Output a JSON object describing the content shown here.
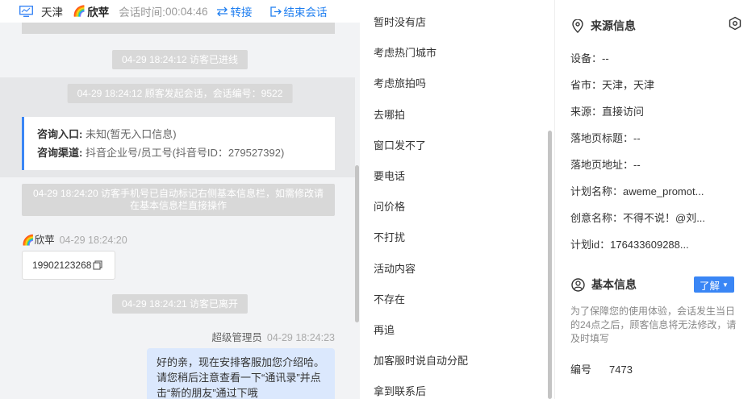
{
  "chat": {
    "header": {
      "city": "天津",
      "agent": "欣苹",
      "timer_label": "会话时间:",
      "timer": "00:04:46",
      "transfer": "转接",
      "end": "结束会话"
    },
    "sys_entered": "04-29 18:24:12 访客已进线",
    "sys_started": "04-29 18:24:12 顾客发起会话，会话编号：9522",
    "consult": {
      "entry_label": "咨询入口:",
      "entry_value": "未知(暂无入口信息)",
      "channel_label": "咨询渠道:",
      "channel_value": "抖音企业号/员工号(抖音号ID：279527392)"
    },
    "sys_phone": "04-29 18:24:20 访客手机号已自动标记右侧基本信息栏，如需修改请在基本信息栏直接操作",
    "agent_msg": {
      "name": "欣苹",
      "time": "04-29 18:24:20",
      "phone": "19902123268"
    },
    "sys_left": "04-29 18:24:21 访客已离开",
    "admin_msg": {
      "name": "超级管理员",
      "time": "04-29 18:24:23",
      "text": "好的亲，现在安排客服加您介绍哈。请您稍后注意查看一下“通讯录”并点击“新的朋友”通过下哦"
    }
  },
  "quick_replies": [
    "暂时没有店",
    "考虑热门城市",
    "考虑旅拍吗",
    "去哪拍",
    "窗口发不了",
    "要电话",
    "问价格",
    "不打扰",
    "活动内容",
    "不存在",
    "再追",
    "加客服时说自动分配",
    "拿到联系后"
  ],
  "info": {
    "source_title": "来源信息",
    "device": "设备：--",
    "province": "省市：天津，天津",
    "source": "来源：直接访问",
    "landing_title": "落地页标题：--",
    "landing_url": "落地页地址：--",
    "plan_name": "计划名称：aweme_promot...",
    "creative_name": "创意名称：不得不说！@刘...",
    "plan_id": "计划id：176433609288...",
    "basic_title": "基本信息",
    "learn_btn": "了解",
    "notice": "为了保障您的使用体验，会话发生当日的24点之后，顾客信息将无法修改，请及时填写",
    "id_label": "编号",
    "id_value": "7473"
  },
  "colors": {
    "accent": "#3a86f5",
    "system_bubble": "#d8d8d8",
    "agent_bubble": "#dbe8fd"
  }
}
